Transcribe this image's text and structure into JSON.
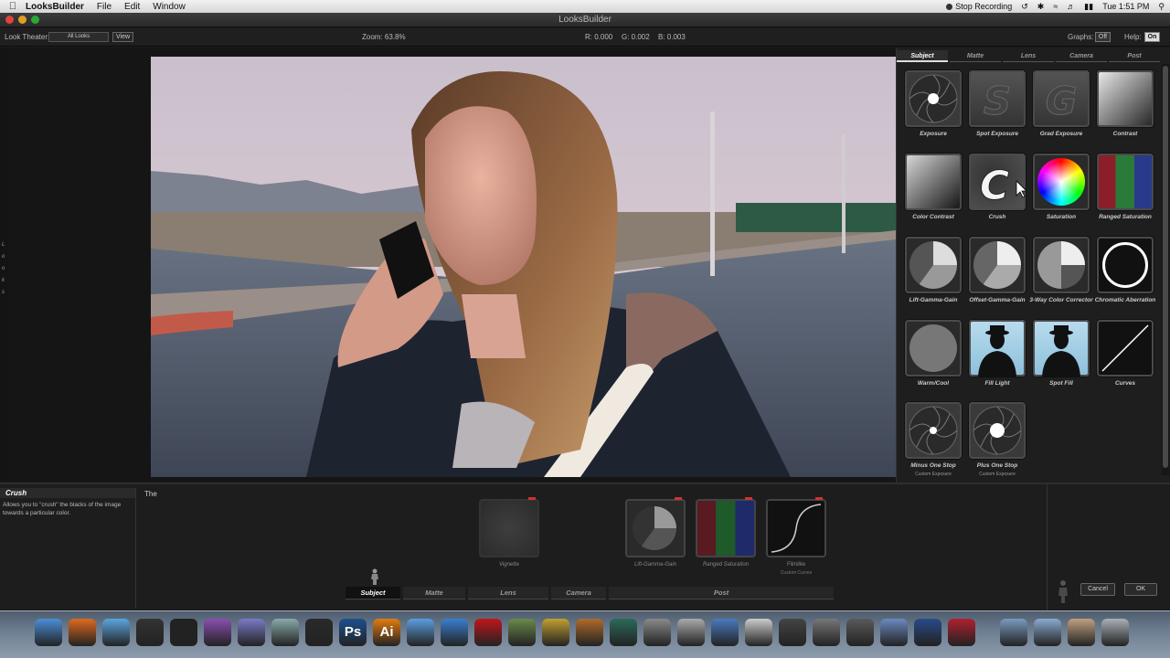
{
  "menubar": {
    "app_name": "LooksBuilder",
    "menus": [
      "File",
      "Edit",
      "Window"
    ],
    "stop_recording": "Stop Recording",
    "clock": "Tue 1:51 PM"
  },
  "window": {
    "title": "LooksBuilder"
  },
  "toolbar": {
    "look_theater_label": "Look Theater:",
    "look_theater_value": "All Looks",
    "view_button": "View",
    "zoom": "Zoom: 63.8%",
    "r": "R: 0.000",
    "g": "G: 0.002",
    "b": "B: 0.003",
    "graphs_label": "Graphs:",
    "graphs_value": "Off",
    "help_label": "Help:",
    "help_value": "On"
  },
  "left_strip_text": "L o o k s",
  "panel": {
    "tabs": [
      "Subject",
      "Matte",
      "Lens",
      "Camera",
      "Post"
    ],
    "active_tab": "Subject",
    "tools": [
      {
        "label": "Exposure",
        "icon": "aperture-dot-icon"
      },
      {
        "label": "Spot Exposure",
        "icon": "spot-s-icon"
      },
      {
        "label": "Grad Exposure",
        "icon": "grad-g-icon"
      },
      {
        "label": "Contrast",
        "icon": "contrast-gradient-icon"
      },
      {
        "label": "Color Contrast",
        "icon": "color-contrast-icon"
      },
      {
        "label": "Crush",
        "icon": "crush-c-icon"
      },
      {
        "label": "Saturation",
        "icon": "color-wheel-icon"
      },
      {
        "label": "Ranged Saturation",
        "icon": "ranged-saturation-icon"
      },
      {
        "label": "Lift-Gamma-Gain",
        "icon": "lift-gamma-gain-icon"
      },
      {
        "label": "Offset-Gamma-Gain",
        "icon": "offset-gamma-gain-icon"
      },
      {
        "label": "3-Way Color Corrector",
        "icon": "three-way-icon"
      },
      {
        "label": "Chromatic Aberration",
        "icon": "chromatic-ring-icon"
      },
      {
        "label": "Warm/Cool",
        "icon": "warm-cool-disc-icon"
      },
      {
        "label": "Fill Light",
        "icon": "fill-light-silhouette-icon"
      },
      {
        "label": "Spot Fill",
        "icon": "spot-fill-silhouette-icon"
      },
      {
        "label": "Curves",
        "icon": "curves-line-icon"
      },
      {
        "label": "Minus One Stop",
        "icon": "aperture-small-dot-icon",
        "sub": "Custom Exposure"
      },
      {
        "label": "Plus One Stop",
        "icon": "aperture-big-dot-icon",
        "sub": "Custom Exposure"
      }
    ]
  },
  "description": {
    "title": "Crush",
    "text": "Allows you to \"crush\" the blacks of the image towards a particular color.",
    "notes": "The"
  },
  "stack": [
    {
      "label": "Vignette",
      "sub": ""
    },
    {
      "label": "Lift-Gamma-Gain",
      "sub": ""
    },
    {
      "label": "Ranged Saturation",
      "sub": ""
    },
    {
      "label": "Filmlike",
      "sub": "Custom Curves"
    }
  ],
  "bottom_tabs": [
    "Subject",
    "Matte",
    "Lens",
    "Camera",
    "Post"
  ],
  "bottom_active_tab": "Subject",
  "buttons": {
    "cancel": "Cancel",
    "ok": "OK"
  },
  "dock": [
    {
      "name": "finder",
      "color": "#4a8fd8",
      "glyph": ""
    },
    {
      "name": "firefox",
      "color": "#e06a1e",
      "glyph": ""
    },
    {
      "name": "safari",
      "color": "#5aa6e0",
      "glyph": ""
    },
    {
      "name": "clapper",
      "color": "#333",
      "glyph": ""
    },
    {
      "name": "final-cut",
      "color": "#222",
      "glyph": ""
    },
    {
      "name": "color-app",
      "color": "#8a4fb0",
      "glyph": ""
    },
    {
      "name": "motion",
      "color": "#7a7ac8",
      "glyph": ""
    },
    {
      "name": "preview",
      "color": "#8aa",
      "glyph": ""
    },
    {
      "name": "bomb",
      "color": "#2a2a2a",
      "glyph": ""
    },
    {
      "name": "photoshop",
      "color": "#1d4f8f",
      "glyph": "Ps"
    },
    {
      "name": "illustrator",
      "color": "#e37b0f",
      "glyph": "Ai"
    },
    {
      "name": "ichat",
      "color": "#5b9ee0",
      "glyph": ""
    },
    {
      "name": "itunes",
      "color": "#3a7fd0",
      "glyph": ""
    },
    {
      "name": "red-app",
      "color": "#c0161b",
      "glyph": ""
    },
    {
      "name": "iphoto",
      "color": "#6a8a4a",
      "glyph": ""
    },
    {
      "name": "imovie",
      "color": "#c0a030",
      "glyph": ""
    },
    {
      "name": "garageband",
      "color": "#b06a2a",
      "glyph": ""
    },
    {
      "name": "time-machine",
      "color": "#2a6a5a",
      "glyph": ""
    },
    {
      "name": "system-prefs",
      "color": "#8a8a8a",
      "glyph": ""
    },
    {
      "name": "utility",
      "color": "#aaa",
      "glyph": ""
    },
    {
      "name": "home",
      "color": "#4a7ac0",
      "glyph": ""
    },
    {
      "name": "eraser",
      "color": "#ccc",
      "glyph": ""
    },
    {
      "name": "camera",
      "color": "#444",
      "glyph": ""
    },
    {
      "name": "network",
      "color": "#777",
      "glyph": ""
    },
    {
      "name": "toolbox",
      "color": "#5a5a5a",
      "glyph": ""
    },
    {
      "name": "screen-app",
      "color": "#6a8ac0",
      "glyph": ""
    },
    {
      "name": "quicktime",
      "color": "#2a4a8a",
      "glyph": ""
    },
    {
      "name": "red-cube",
      "color": "#b02030",
      "glyph": ""
    },
    {
      "name": "applications-folder",
      "color": "#7a9ac0",
      "glyph": ""
    },
    {
      "name": "documents-folder",
      "color": "#8aaad0",
      "glyph": ""
    },
    {
      "name": "stack-photo",
      "color": "#c0a080",
      "glyph": ""
    },
    {
      "name": "trash",
      "color": "#aab0b8",
      "glyph": ""
    }
  ]
}
